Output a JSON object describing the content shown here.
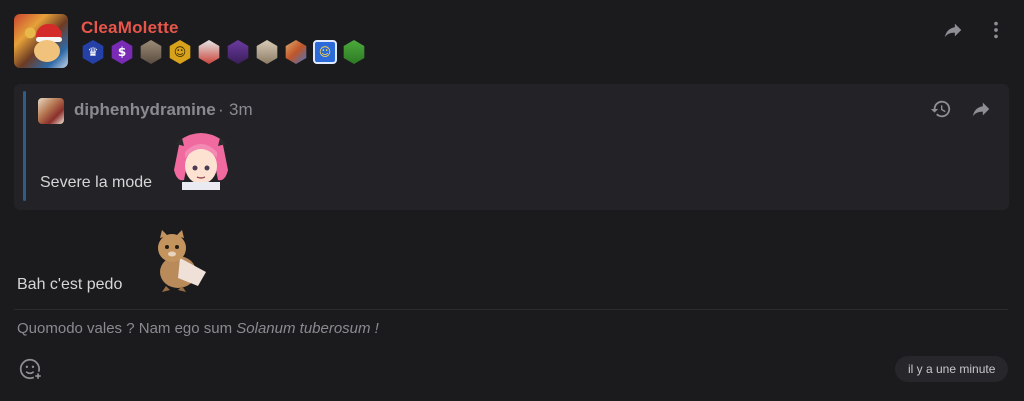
{
  "post": {
    "author": "CleaMolette",
    "badges": [
      {
        "icon": "crown-badge",
        "color": "#2541a8"
      },
      {
        "icon": "dollar-badge",
        "color": "#7a2bb5"
      },
      {
        "icon": "portrait-badge",
        "color": "#8a7a6a"
      },
      {
        "icon": "face-badge",
        "color": "#d9a21b"
      },
      {
        "icon": "character-badge",
        "color": "#c8443a"
      },
      {
        "icon": "character-badge",
        "color": "#6b3aa0"
      },
      {
        "icon": "animal-badge",
        "color": "#b9a890"
      },
      {
        "icon": "palette-badge",
        "color": "#c07a2a"
      },
      {
        "icon": "smiley-badge",
        "color": "#2c6ad9"
      },
      {
        "icon": "figure-badge",
        "color": "#4caa3c"
      }
    ],
    "quote": {
      "author": "diphenhydramine",
      "separator": "·",
      "time": "3m",
      "text": "Severe la mode"
    },
    "text": "Bah c'est pedo",
    "signature": {
      "plain": "Quomodo vales ? Nam ego sum ",
      "italic": "Solanum tuberosum !"
    },
    "timestamp": "il y a une minute"
  },
  "colors": {
    "background": "#1b1b1e",
    "quote_background": "#232327",
    "quote_bar": "#2f5d8a",
    "author": "#e8564a",
    "muted": "#8a8a90"
  }
}
